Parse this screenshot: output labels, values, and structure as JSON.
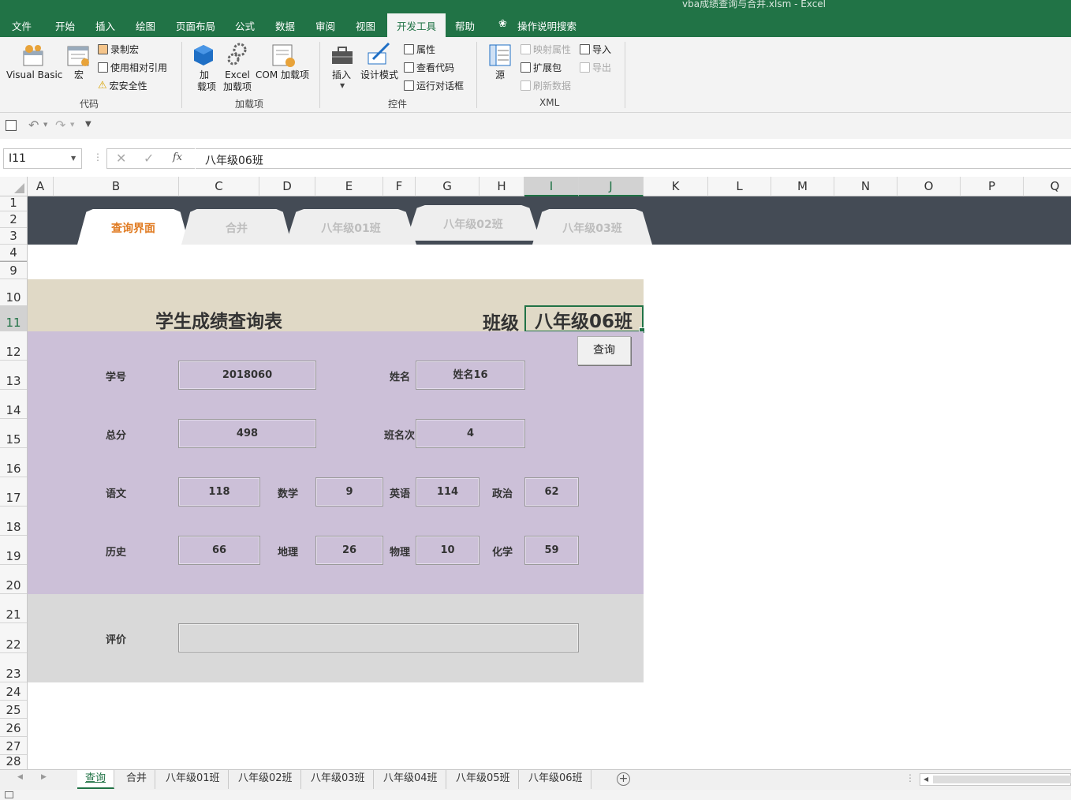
{
  "window_title": "vba成绩查询与合并.xlsm  -  Excel",
  "menu": {
    "items": [
      "文件",
      "开始",
      "插入",
      "绘图",
      "页面布局",
      "公式",
      "数据",
      "审阅",
      "视图",
      "开发工具",
      "帮助"
    ],
    "active": "开发工具",
    "search_label": "操作说明搜索"
  },
  "ribbon": {
    "code_group": {
      "label": "代码",
      "visual_basic": "Visual Basic",
      "macros": "宏",
      "record_macro": "录制宏",
      "relative_ref": "使用相对引用",
      "macro_security": "宏安全性"
    },
    "addins_group": {
      "label": "加载项",
      "addins_line1": "加",
      "addins_line2": "载项",
      "excel_addins_line1": "Excel",
      "excel_addins_line2": "加载项",
      "com_addins": "COM 加载项"
    },
    "controls_group": {
      "label": "控件",
      "insert": "插入",
      "design_mode": "设计模式",
      "properties": "属性",
      "view_code": "查看代码",
      "run_dialog": "运行对话框"
    },
    "xml_group": {
      "label": "XML",
      "source": "源",
      "map_properties": "映射属性",
      "expansion_packs": "扩展包",
      "refresh_data": "刷新数据",
      "import": "导入",
      "export": "导出"
    }
  },
  "formula_bar": {
    "name_box": "I11",
    "fx": "fx",
    "value": "八年级06班"
  },
  "columns": [
    "A",
    "B",
    "C",
    "D",
    "E",
    "F",
    "G",
    "H",
    "I",
    "J",
    "K",
    "L",
    "M",
    "N",
    "O",
    "P",
    "Q"
  ],
  "selected_column": "I",
  "rows": [
    "1",
    "2",
    "3",
    "4",
    "9",
    "10",
    "11",
    "12",
    "13",
    "14",
    "15",
    "16",
    "17",
    "18",
    "19",
    "20",
    "21",
    "22",
    "23",
    "24",
    "25",
    "26",
    "27",
    "28"
  ],
  "selected_row": "11",
  "nav_tabs": [
    "查询界面",
    "合并",
    "八年级01班",
    "八年级02班",
    "八年级03班"
  ],
  "nav_active": "查询界面",
  "sheet": {
    "title": "学生成绩查询表",
    "class_label": "班级",
    "class_value": "八年级06班",
    "query_button": "查询",
    "labels": {
      "student_id": "学号",
      "name": "姓名",
      "total": "总分",
      "class_rank": "班名次",
      "chinese": "语文",
      "math": "数学",
      "english": "英语",
      "politics": "政治",
      "history": "历史",
      "geography": "地理",
      "physics": "物理",
      "chemistry": "化学",
      "comment": "评价"
    },
    "values": {
      "student_id": "2018060",
      "name": "姓名16",
      "total": "498",
      "class_rank": "4",
      "chinese": "118",
      "math": "9",
      "english": "114",
      "politics": "62",
      "history": "66",
      "geography": "26",
      "physics": "10",
      "chemistry": "59",
      "comment": ""
    }
  },
  "sheet_tabs": [
    "查询",
    "合并",
    "八年级01班",
    "八年级02班",
    "八年级03班",
    "八年级04班",
    "八年级05班",
    "八年级06班"
  ],
  "active_sheet": "查询",
  "colors": {
    "excel_green": "#217346",
    "dark_band": "#444b55",
    "title_band": "#e0d9c6",
    "form_band": "#ccc0d8",
    "comment_band": "#d9d9d9",
    "nav_active_text": "#e07b22"
  }
}
